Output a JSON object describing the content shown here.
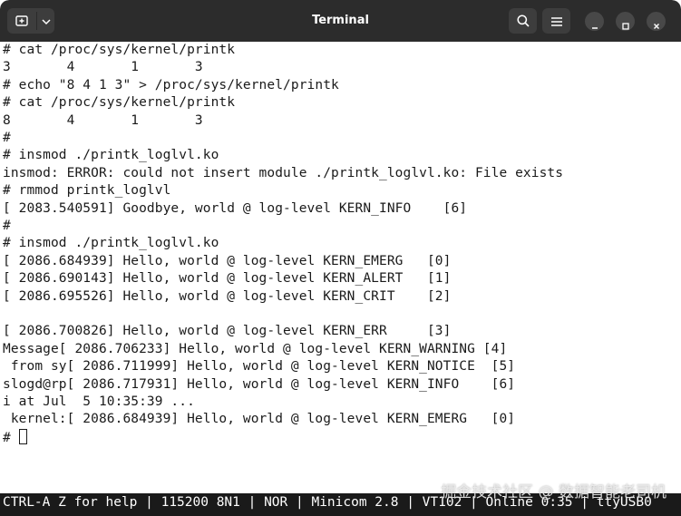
{
  "window": {
    "title": "Terminal"
  },
  "icons": {
    "new_tab": "new-tab-icon",
    "dropdown": "chevron-down-icon",
    "search": "search-icon",
    "menu": "hamburger-menu-icon",
    "minimize": "minimize-icon",
    "maximize": "maximize-icon",
    "close": "close-icon"
  },
  "terminal": {
    "lines": [
      "# cat /proc/sys/kernel/printk",
      "3       4       1       3",
      "# echo \"8 4 1 3\" > /proc/sys/kernel/printk",
      "# cat /proc/sys/kernel/printk",
      "8       4       1       3",
      "#",
      "# insmod ./printk_loglvl.ko",
      "insmod: ERROR: could not insert module ./printk_loglvl.ko: File exists",
      "# rmmod printk_loglvl",
      "[ 2083.540591] Goodbye, world @ log-level KERN_INFO    [6]",
      "#",
      "# insmod ./printk_loglvl.ko",
      "[ 2086.684939] Hello, world @ log-level KERN_EMERG   [0]",
      "[ 2086.690143] Hello, world @ log-level KERN_ALERT   [1]",
      "[ 2086.695526] Hello, world @ log-level KERN_CRIT    [2]",
      "",
      "[ 2086.700826] Hello, world @ log-level KERN_ERR     [3]",
      "Message[ 2086.706233] Hello, world @ log-level KERN_WARNING [4]",
      " from sy[ 2086.711999] Hello, world @ log-level KERN_NOTICE  [5]",
      "slogd@rp[ 2086.717931] Hello, world @ log-level KERN_INFO    [6]",
      "i at Jul  5 10:35:39 ...",
      " kernel:[ 2086.684939] Hello, world @ log-level KERN_EMERG   [0]"
    ],
    "prompt": "# "
  },
  "status_bar": {
    "text": "CTRL-A Z for help | 115200 8N1 | NOR | Minicom 2.8 | VT102 | Online 0:35 | ttyUSB0"
  },
  "watermark": {
    "text": "掘金技术社区 @ 数据智能老司机"
  },
  "colors": {
    "titlebar": "#2c2c2c",
    "terminal_bg": "#ffffff",
    "terminal_fg": "#1a1a1a",
    "statusbar_bg": "#1a1a1a",
    "statusbar_fg": "#ffffff"
  }
}
